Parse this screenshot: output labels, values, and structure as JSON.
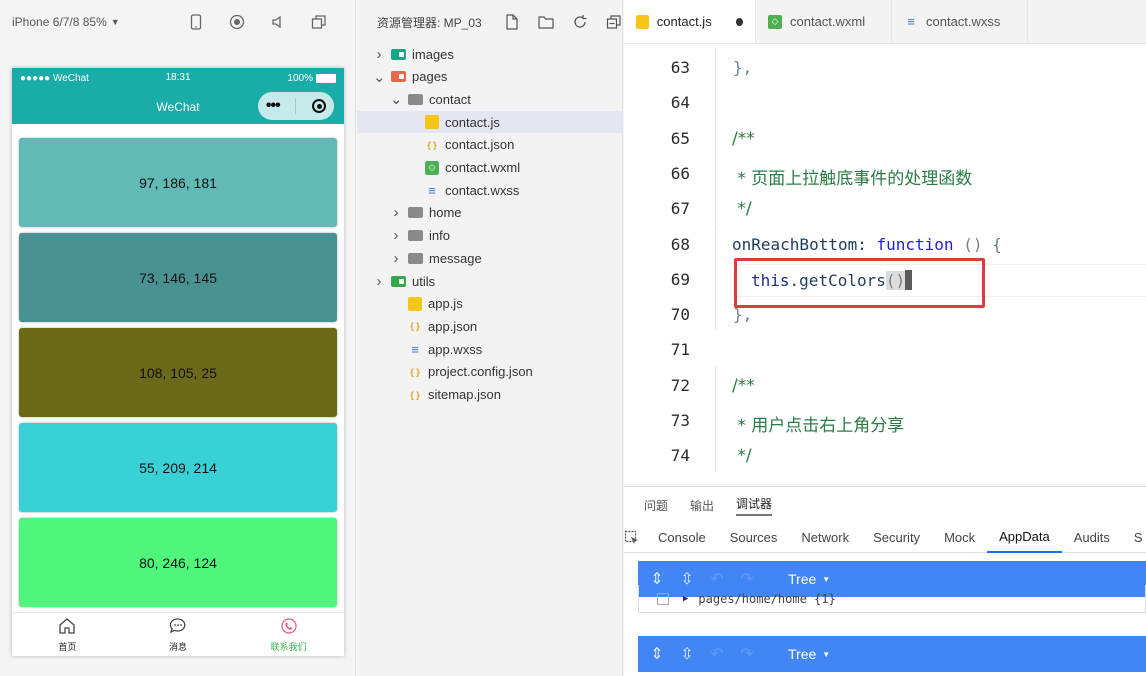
{
  "simulator": {
    "device_label": "iPhone 6/7/8 85%",
    "status_carrier": "●●●●● WeChat",
    "status_time": "18:31",
    "status_battery": "100%",
    "nav_title": "WeChat",
    "colors": [
      {
        "label": "97, 186, 181",
        "color": "#61bab5"
      },
      {
        "label": "73, 146, 145",
        "color": "#499291"
      },
      {
        "label": "108, 105, 25",
        "color": "#6c6919"
      },
      {
        "label": "55, 209, 214",
        "color": "#37d1d6"
      },
      {
        "label": "80, 246, 124",
        "color": "#50f67c"
      }
    ],
    "partial_color": "#9b5ff0",
    "tabbar": [
      {
        "label": "首页",
        "icon": "home-icon"
      },
      {
        "label": "消息",
        "icon": "message-icon"
      },
      {
        "label": "联系我们",
        "icon": "phone-icon"
      }
    ]
  },
  "explorer": {
    "title": "资源管理器: MP_03",
    "tree": [
      {
        "label": "images",
        "kind": "folder-special",
        "color": "#1aa58a",
        "depth": 0,
        "expanded": false
      },
      {
        "label": "pages",
        "kind": "folder-special",
        "color": "#e8664a",
        "depth": 0,
        "expanded": true
      },
      {
        "label": "contact",
        "kind": "folder",
        "color": "#8a8a8a",
        "depth": 1,
        "expanded": true
      },
      {
        "label": "contact.js",
        "kind": "js",
        "depth": 2,
        "selected": true
      },
      {
        "label": "contact.json",
        "kind": "json",
        "depth": 2
      },
      {
        "label": "contact.wxml",
        "kind": "wxml",
        "depth": 2
      },
      {
        "label": "contact.wxss",
        "kind": "wxss",
        "depth": 2
      },
      {
        "label": "home",
        "kind": "folder",
        "color": "#8a8a8a",
        "depth": 1,
        "expanded": false
      },
      {
        "label": "info",
        "kind": "folder",
        "color": "#8a8a8a",
        "depth": 1,
        "expanded": false
      },
      {
        "label": "message",
        "kind": "folder",
        "color": "#8a8a8a",
        "depth": 1,
        "expanded": false
      },
      {
        "label": "utils",
        "kind": "folder-special",
        "color": "#3aa64a",
        "depth": 0,
        "expanded": false
      },
      {
        "label": "app.js",
        "kind": "js",
        "depth": 1
      },
      {
        "label": "app.json",
        "kind": "json",
        "depth": 1
      },
      {
        "label": "app.wxss",
        "kind": "wxss",
        "depth": 1
      },
      {
        "label": "project.config.json",
        "kind": "json",
        "depth": 1
      },
      {
        "label": "sitemap.json",
        "kind": "json",
        "depth": 1
      }
    ]
  },
  "editor": {
    "tabs": [
      {
        "label": "contact.js",
        "kind": "js",
        "active": true,
        "dirty": true
      },
      {
        "label": "contact.wxml",
        "kind": "wxml",
        "active": false
      },
      {
        "label": "contact.wxss",
        "kind": "wxss",
        "active": false
      }
    ],
    "lines": [
      {
        "n": "63",
        "text": "},"
      },
      {
        "n": "64",
        "text": ""
      },
      {
        "n": "65",
        "text": "/**"
      },
      {
        "n": "66",
        "text": " * 页面上拉触底事件的处理函数"
      },
      {
        "n": "67",
        "text": " */"
      },
      {
        "n": "68",
        "prop": "onReachBottom",
        "colon": ": ",
        "kw": "function",
        "rest": " () {"
      },
      {
        "n": "69",
        "this": "this",
        "dot": ".",
        "method": "getColors",
        "parens": "()"
      },
      {
        "n": "70",
        "text": "},"
      },
      {
        "n": "71",
        "text": ""
      },
      {
        "n": "72",
        "text": "/**"
      },
      {
        "n": "73",
        "text": " * 用户点击右上角分享"
      },
      {
        "n": "74",
        "text": " */"
      }
    ]
  },
  "debug": {
    "panel_tabs": [
      "问题",
      "输出",
      "调试器"
    ],
    "active_panel": "调试器",
    "dev_tabs": [
      "Console",
      "Sources",
      "Network",
      "Security",
      "Mock",
      "AppData",
      "Audits",
      "S"
    ],
    "active_dev_tab": "AppData",
    "tree_label": "Tree",
    "data_row": "pages/home/home {1}"
  }
}
